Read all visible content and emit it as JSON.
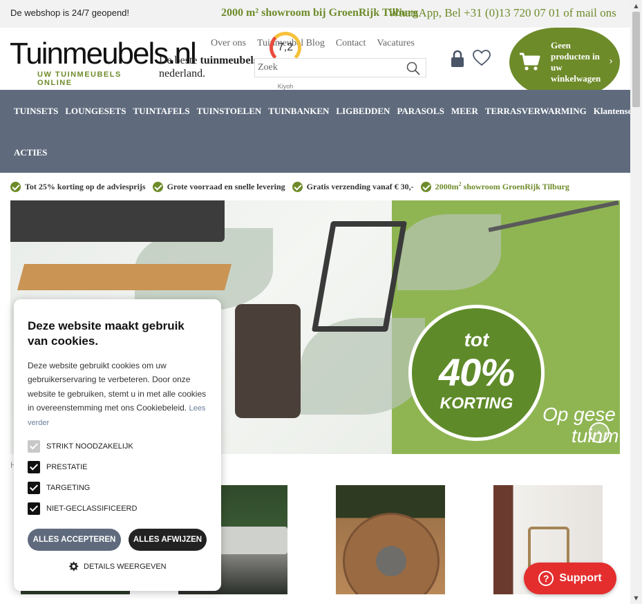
{
  "topbar": {
    "left_text": "De webshop is 24/7 geopend!",
    "promo_text": "2000 m² showroom bij GroenRijk Tilburg",
    "contact_text": "WhatsApp, Bel +31 (0)13 720 07 01 of mail ons"
  },
  "header": {
    "logo_text": "Tuinmeubels.nl",
    "logo_tagline": "UW TUINMEUBELS ONLINE",
    "tagline_pre": "De beste ",
    "tagline_bold": "tuinmeubels",
    "tagline_post": " van nederland.",
    "topnav": [
      "Over ons",
      "Tuinmeubel Blog",
      "Contact",
      "Vacatures"
    ],
    "kiyoh_score": "7,2",
    "kiyoh_label": "Kiyoh",
    "search_placeholder": "Zoek",
    "cart_text": "Geen producten in uw winkelwagen"
  },
  "mainnav": {
    "row1": [
      "TUINSETS",
      "LOUNGESETS",
      "TUINTAFELS",
      "TUINSTOELEN",
      "TUINBANKEN",
      "LIGBEDDEN",
      "PARASOLS",
      "MEER",
      "TERRASVERWARMING",
      "Klantenservice"
    ],
    "row2": [
      "ACTIES"
    ]
  },
  "usps": [
    {
      "text": "Tot 25% korting op de adviesprijs"
    },
    {
      "text": "Grote voorraad en snelle levering"
    },
    {
      "text": "Gratis verzending vanaf € 30,-"
    },
    {
      "text_pre": "2000m",
      "text_sup": "2",
      "text_post": " showroom GroenRijk Tilburg"
    }
  ],
  "hero": {
    "badge_top": "tot",
    "badge_pct": "40%",
    "badge_bottom": "KORTING",
    "slogan_line1": "Op gese",
    "slogan_line2": "tuinm"
  },
  "hidden_heading": "H",
  "cookie": {
    "title": "Deze website maakt gebruik van cookies.",
    "body": "Deze website gebruikt cookies om uw gebruikerservaring te verbeteren. Door onze website te gebruiken, stemt u in met alle cookies in overeenstemming met ons Cookiebeleid.",
    "read_more": "Lees verder",
    "options": [
      {
        "label": "STRIKT NOODZAKELIJK",
        "checked": true,
        "disabled": true
      },
      {
        "label": "PRESTATIE",
        "checked": true,
        "disabled": false
      },
      {
        "label": "TARGETING",
        "checked": true,
        "disabled": false
      },
      {
        "label": "NIET-GECLASSIFICEERD",
        "checked": true,
        "disabled": false
      }
    ],
    "accept_label": "ALLES ACCEPTEREN",
    "reject_label": "ALLES AFWIJZEN",
    "details_label": "DETAILS WEERGEVEN"
  },
  "support": {
    "label": "Support",
    "icon_glyph": "?"
  },
  "colors": {
    "brand_green": "#6e8b2a",
    "nav_bg": "#5f6b7d",
    "support_red": "#e42e2e"
  }
}
